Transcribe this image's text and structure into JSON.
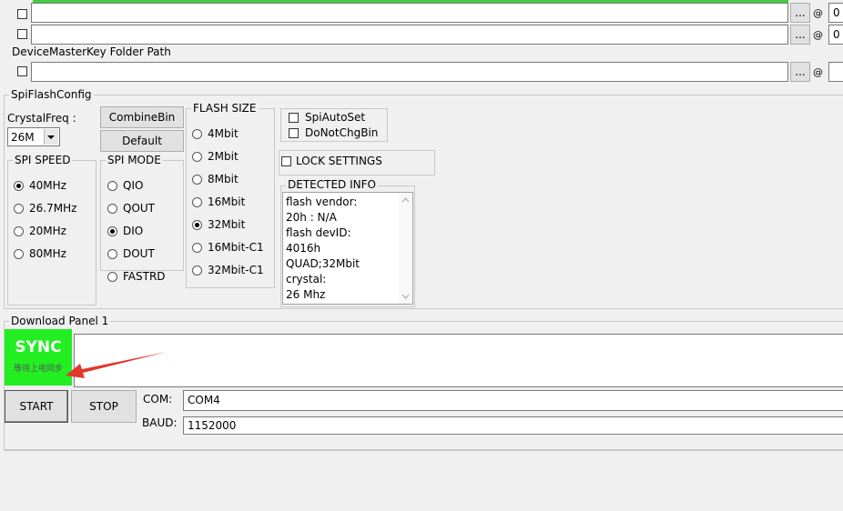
{
  "paths": {
    "browse_label": "...",
    "at_symbol": "@",
    "row1_offset": "0",
    "row2_offset": "0",
    "devmaster_label": "DeviceMasterKey Folder Path"
  },
  "spi_flash_config": {
    "title": "SpiFlashConfig",
    "crystal_label": "CrystalFreq :",
    "crystal_value": "26M",
    "combine_bin": "CombineBin",
    "default": "Default",
    "spi_speed": {
      "title": "SPI SPEED",
      "options": [
        "40MHz",
        "26.7MHz",
        "20MHz",
        "80MHz"
      ],
      "selected": "40MHz"
    },
    "spi_mode": {
      "title": "SPI MODE",
      "options": [
        "QIO",
        "QOUT",
        "DIO",
        "DOUT",
        "FASTRD"
      ],
      "selected": "DIO"
    },
    "flash_size": {
      "title": "FLASH SIZE",
      "options": [
        "4Mbit",
        "2Mbit",
        "8Mbit",
        "16Mbit",
        "32Mbit",
        "16Mbit-C1",
        "32Mbit-C1"
      ],
      "selected": "32Mbit"
    },
    "spi_auto_set": "SpiAutoSet",
    "do_not_chg_bin": "DoNotChgBin",
    "lock_settings": "LOCK SETTINGS",
    "detected_info": {
      "title": "DETECTED INFO",
      "lines": [
        "flash vendor:",
        "20h : N/A",
        "flash devID:",
        "4016h",
        "QUAD;32Mbit",
        "crystal:",
        "26 Mhz"
      ]
    }
  },
  "download_panel": {
    "title": "Download Panel 1",
    "status_title": "SYNC",
    "status_sub": "等待上电同步",
    "status_color": "#22ee22",
    "arrow_color": "#e0382c",
    "start": "START",
    "stop": "STOP",
    "com_label": "COM:",
    "com_value": "COM4",
    "baud_label": "BAUD:",
    "baud_value": "1152000"
  }
}
